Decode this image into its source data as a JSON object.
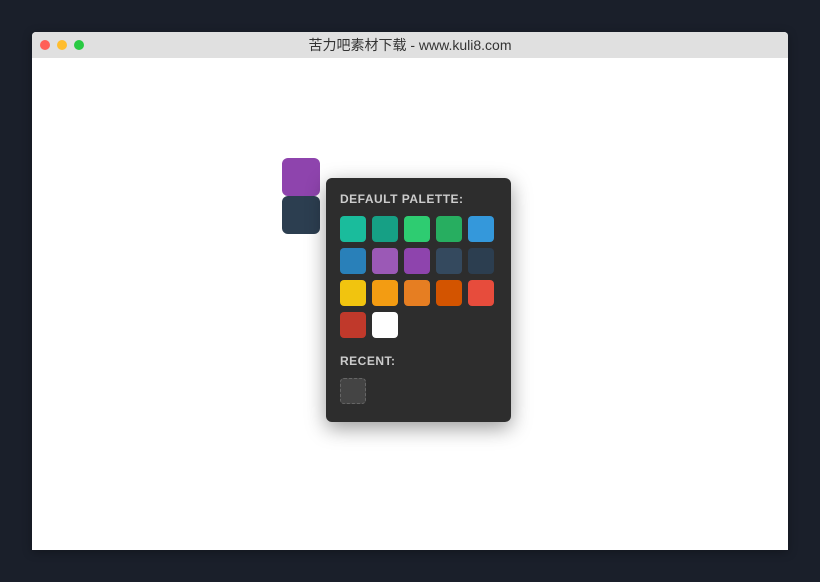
{
  "window": {
    "title": "苦力吧素材下载 - www.kuli8.com"
  },
  "swatches": {
    "primary": "#8e44ad",
    "secondary": "#2c3e50"
  },
  "palette": {
    "default_label": "DEFAULT PALETTE:",
    "recent_label": "RECENT:",
    "colors": [
      "#1abc9c",
      "#16a085",
      "#2ecc71",
      "#27ae60",
      "#3498db",
      "#2980b9",
      "#9b59b6",
      "#8e44ad",
      "#34495e",
      "#2c3e50",
      "#f1c40f",
      "#f39c12",
      "#e67e22",
      "#d35400",
      "#e74c3c",
      "#c0392b",
      "#ffffff"
    ],
    "selected_index": 16,
    "recent": [
      null
    ]
  }
}
